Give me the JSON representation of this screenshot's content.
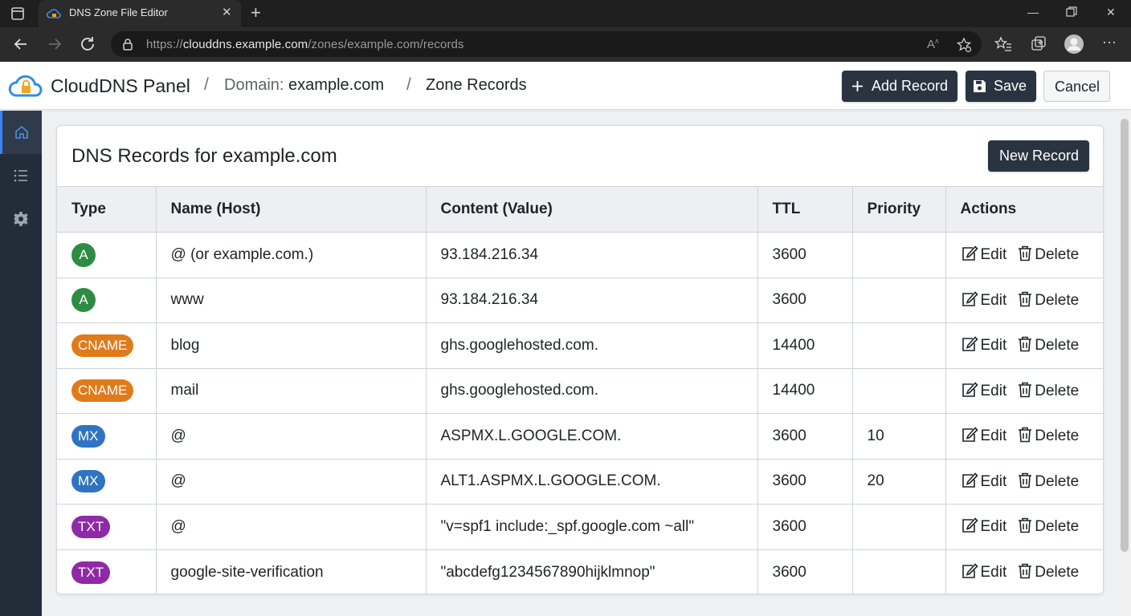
{
  "browser": {
    "tab_title": "DNS Zone File Editor",
    "url_prefix": "https://",
    "url_host": "clouddns.example.com",
    "url_path": "/zones/example.com/records"
  },
  "header": {
    "brand": "CloudDNS Panel",
    "separator": "/",
    "domain_label": "Domain:",
    "domain_value": "example.com",
    "zone_label": "Zone Records",
    "add_record": "Add Record",
    "save": "Save",
    "cancel": "Cancel"
  },
  "card": {
    "title": "DNS Records for example.com",
    "new_record": "New Record"
  },
  "table": {
    "headers": [
      "Type",
      "Name (Host)",
      "Content (Value)",
      "TTL",
      "Priority",
      "Actions"
    ],
    "edit_label": "Edit",
    "delete_label": "Delete",
    "rows": [
      {
        "type": "A",
        "name": "@ (or example.com.)",
        "content": "93.184.216.34",
        "ttl": "3600",
        "priority": ""
      },
      {
        "type": "A",
        "name": "www",
        "content": "93.184.216.34",
        "ttl": "3600",
        "priority": ""
      },
      {
        "type": "CNAME",
        "name": "blog",
        "content": "ghs.googlehosted.com.",
        "ttl": "14400",
        "priority": ""
      },
      {
        "type": "CNAME",
        "name": "mail",
        "content": "ghs.googlehosted.com.",
        "ttl": "14400",
        "priority": ""
      },
      {
        "type": "MX",
        "name": "@",
        "content": "ASPMX.L.GOOGLE.COM.",
        "ttl": "3600",
        "priority": "10"
      },
      {
        "type": "MX",
        "name": "@",
        "content": "ALT1.ASPMX.L.GOOGLE.COM.",
        "ttl": "3600",
        "priority": "20"
      },
      {
        "type": "TXT",
        "name": "@",
        "content": "\"v=spf1 include:_spf.google.com ~all\"",
        "ttl": "3600",
        "priority": ""
      },
      {
        "type": "TXT",
        "name": "google-site-verification",
        "content": "\"abcdefg1234567890hijklmnop\"",
        "ttl": "3600",
        "priority": ""
      }
    ]
  },
  "badge_colors": {
    "A": "#2e8b45",
    "CNAME": "#e07b1a",
    "MX": "#2f74c0",
    "TXT": "#8e2aa6"
  },
  "sidebar": {
    "items": [
      "home-icon",
      "list-icon",
      "gear-icon"
    ],
    "active_color": "#3b82f6"
  }
}
